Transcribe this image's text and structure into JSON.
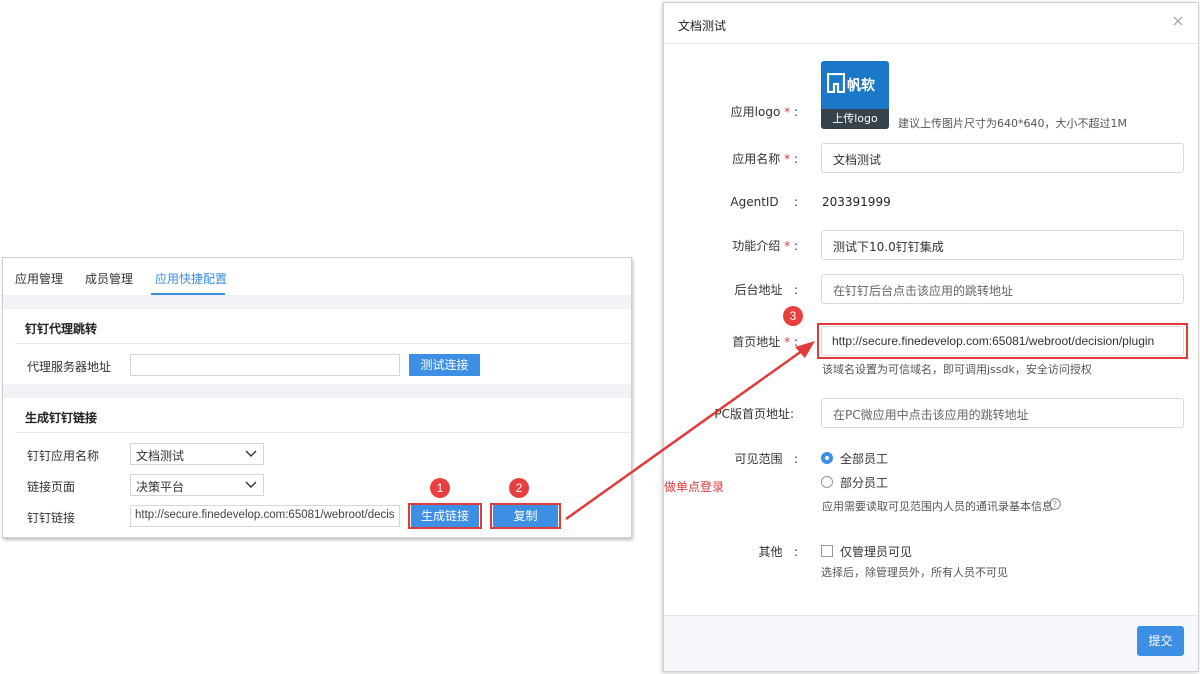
{
  "left": {
    "tabs": [
      "应用管理",
      "成员管理",
      "应用快捷配置"
    ],
    "proxy_section": {
      "title": "钉钉代理跳转",
      "server_label": "代理服务器地址",
      "server_value": "",
      "test_button": "测试连接"
    },
    "link_section": {
      "title": "生成钉钉链接",
      "app_name_label": "钉钉应用名称",
      "app_name_value": "文档测试",
      "page_label": "链接页面",
      "page_value": "决策平台",
      "link_label": "钉钉链接",
      "link_value": "http://secure.finedevelop.com:65081/webroot/decis",
      "generate_button": "生成链接",
      "copy_button": "复制"
    }
  },
  "dialog": {
    "title": "文档测试",
    "logo_label": "应用logo",
    "logo_brand": "帆软",
    "logo_caption": "上传logo",
    "logo_hint": "建议上传图片尺寸为640*640，大小不超过1M",
    "app_name_label": "应用名称",
    "app_name_value": "文档测试",
    "agentid_label": "AgentID",
    "agentid_value": "203391999",
    "intro_label": "功能介绍",
    "intro_value": "测试下10.0钉钉集成",
    "backend_label": "后台地址",
    "backend_placeholder": "在钉钉后台点击该应用的跳转地址",
    "homepage_label": "首页地址",
    "homepage_value": "http://secure.finedevelop.com:65081/webroot/decision/plugin",
    "homepage_hint": "该域名设置为可信域名，即可调用jssdk，安全访问授权",
    "pc_label": "PC版首页地址:",
    "pc_placeholder": "在PC微应用中点击该应用的跳转地址",
    "scope_label": "可见范围",
    "scope_options": [
      "全部员工",
      "部分员工"
    ],
    "scope_hint": "应用需要读取可见范围内人员的通讯录基本信息",
    "other_label": "其他",
    "admin_only_label": "仅管理员可见",
    "admin_only_hint": "选择后，除管理员外，所有人员不可见",
    "submit": "提交",
    "required_mark": "*",
    "colon": ":"
  },
  "annotations": {
    "steps": [
      "1",
      "2",
      "3"
    ],
    "sso_note": "做单点登录"
  },
  "colors": {
    "accent": "#3d8fe5",
    "highlight": "#e03a3a"
  }
}
